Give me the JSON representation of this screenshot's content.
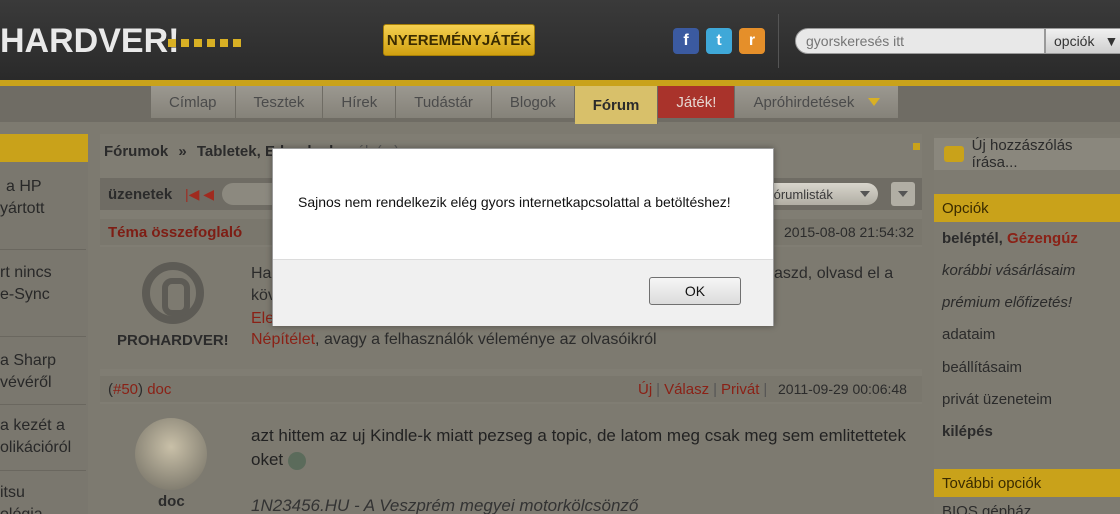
{
  "header": {
    "logo": "HARDVER!",
    "promo_label": "NYEREMÉNYJÁTÉK",
    "social": {
      "facebook": "f",
      "twitter": "t",
      "rss": "r"
    },
    "search": {
      "placeholder": "gyorskeresés itt",
      "options_label": "opciók"
    }
  },
  "nav": {
    "items": [
      "Címlap",
      "Tesztek",
      "Hírek",
      "Tudástár",
      "Blogok",
      "Fórum",
      "Játék!",
      "Apróhirdetések"
    ],
    "active": "Fórum"
  },
  "left_sidebar": {
    "items": [
      [
        "a HP",
        "yártott"
      ],
      [
        "rt nincs",
        "e-Sync"
      ],
      [
        "a Sharp",
        "vévéről"
      ],
      [
        "a kezét a",
        "olikációról"
      ],
      [
        "itsu",
        "ológia"
      ]
    ]
  },
  "breadcrumb": {
    "root": "Fórumok",
    "sep": "»",
    "section": "Tabletek, E-book ol",
    "rest": "vasók (...)"
  },
  "toolbar": {
    "label": "üzenetek",
    "forum_lists": "fórumlisták"
  },
  "summary": {
    "title": "Téma összefoglaló",
    "date": "2015-08-08 21:54:32",
    "author_label": "PROHARDVER!",
    "line1_left": "Ha",
    "line1_right": "aszd, olvasd el a",
    "line2": "köv",
    "line3": "Ele",
    "line4_link": "Népítélet",
    "line4_rest": ", avagy a felhasználók véleménye az olvasóikról"
  },
  "post": {
    "number": "#50",
    "author": "doc",
    "actions": [
      "Új",
      "Válasz",
      "Privát"
    ],
    "date": "2011-09-29 00:06:48",
    "text": "azt hittem az uj Kindle-k miatt pezseg a topic, de latom meg csak meg sem emlitettetek oket",
    "signature": "1N23456.HU - A Veszprém megyei motorkölcsönző"
  },
  "right_sidebar": {
    "new_comment": "Új hozzászólás írása...",
    "options_title": "Opciók",
    "login_label": "beléptél,",
    "user_name": "Gézengúz",
    "items": [
      "korábbi vásárlásaim",
      "prémium előfizetés!",
      "adataim",
      "beállításaim",
      "privát üzeneteim",
      "kilépés"
    ],
    "more_title": "További opciók",
    "more_first": "BIOS gépház"
  },
  "dialog": {
    "message": "Sajnos nem rendelkezik elég gyors internetkapcsolattal a betöltéshez!",
    "ok_label": "OK"
  },
  "colors": {
    "accent": "#c9a21a",
    "link_red": "#8a2116",
    "dialog_bg": "#ffffff"
  }
}
